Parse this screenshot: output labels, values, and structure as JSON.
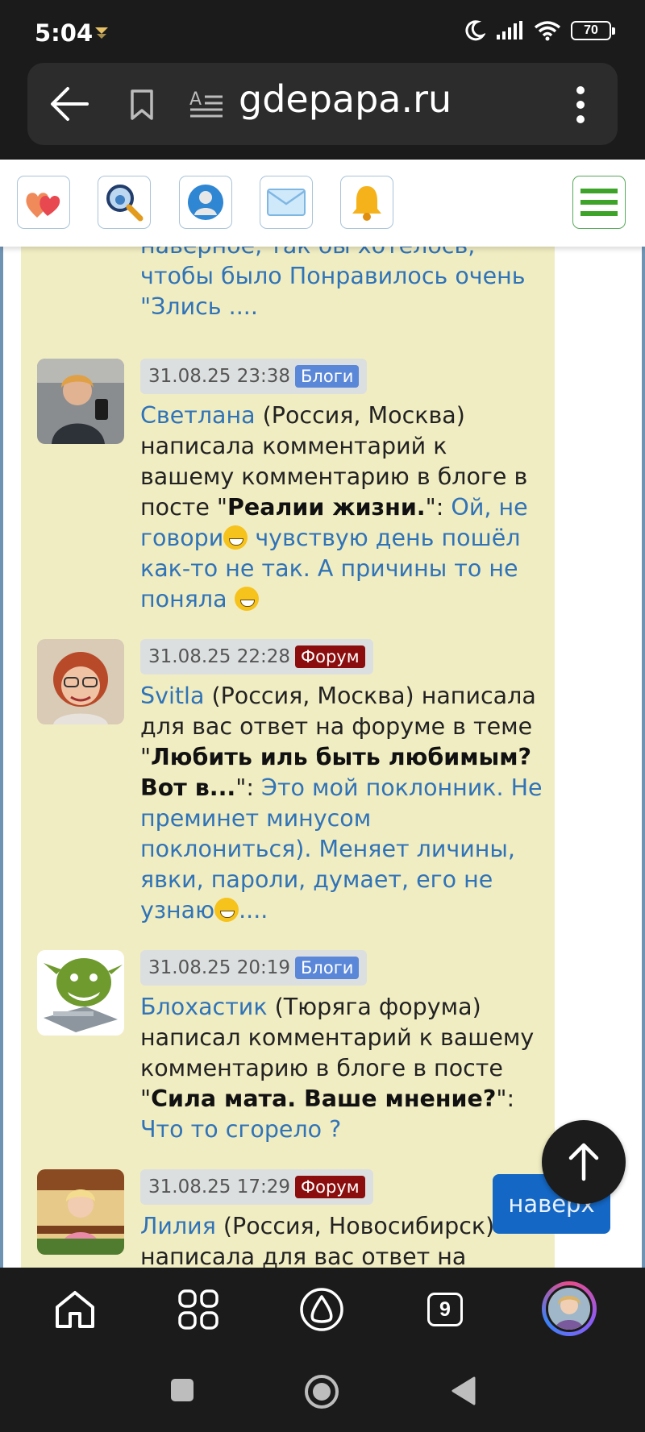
{
  "status": {
    "time": "5:04",
    "battery": "70"
  },
  "browser": {
    "url": "gdepapa.ru"
  },
  "toolbar": {
    "icons": [
      "hearts-icon",
      "search-icon",
      "profile-icon",
      "mail-icon",
      "bell-icon",
      "hamburger-menu-icon"
    ]
  },
  "previous_snippet": {
    "line1": "наверное, так бы хотелось,",
    "line2": "чтобы было Понравилось очень",
    "line3": "\"Злись ...."
  },
  "comments": [
    {
      "timestamp": "31.08.25 23:38",
      "badge": "Блоги",
      "author": "Светлана",
      "location": " (Россия, Москва) написала комментарий к вашему комментарию в блоге в посте \"",
      "topic": "Реалии жизни.",
      "after_topic": "\": ",
      "quote": "Ой, не говори",
      "quote_tail": " чувствую день пошёл как-то не так. А причины то не поняла "
    },
    {
      "timestamp": "31.08.25 22:28",
      "badge": "Форум",
      "author": "Svitla",
      "location": " (Россия, Москва) написала для вас ответ на форуме в теме \"",
      "topic": "Любить иль быть любимым? Вот в...",
      "after_topic": "\": ",
      "quote": "Это мой поклонник. Не преминет минусом поклониться). Меняет личины, явки, пароли, думает, его не узнаю",
      "quote_tail": "...."
    },
    {
      "timestamp": "31.08.25 20:19",
      "badge": "Блоги",
      "author": "Блохастик",
      "location": " (Тюряга форума) написал комментарий к вашему комментарию в блоге в посте \"",
      "topic": "Сила мата. Ваше мнение?",
      "after_topic": "\": ",
      "quote": "Что то сгорело ?"
    },
    {
      "timestamp": "31.08.25 17:29",
      "badge": "Форум",
      "author": "Лилия",
      "location": " (Россия, Новосибирск) написала для вас ответ на"
    }
  ],
  "floating": {
    "naverh": "наверх"
  },
  "bottom_nav": {
    "tabs_count": "9"
  },
  "colors": {
    "link": "#2f73b8",
    "blog_badge": "#5b87d8",
    "forum_badge": "#8b0d0d",
    "panel": "#f1edc2"
  }
}
